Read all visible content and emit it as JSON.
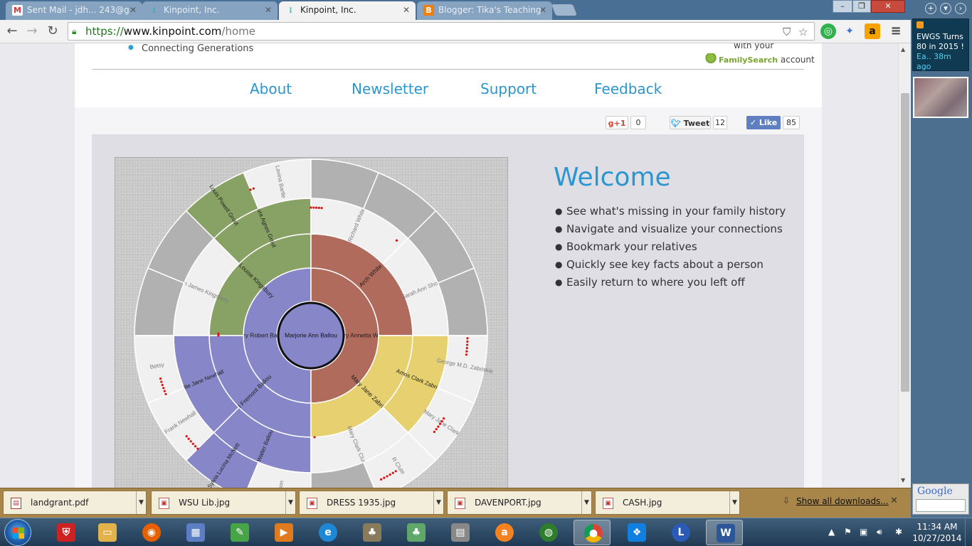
{
  "browser": {
    "tabs": [
      {
        "title": "Sent Mail - jdh... 243@g",
        "icon": "gmail-icon",
        "active": false
      },
      {
        "title": "Kinpoint, Inc.",
        "icon": "kinpoint-icon",
        "active": false
      },
      {
        "title": "Kinpoint, Inc.",
        "icon": "kinpoint-icon",
        "active": true
      },
      {
        "title": "Blogger: Tika's Teaching",
        "icon": "blogger-icon",
        "active": false
      }
    ],
    "url_scheme": "https://",
    "url_host": "www.kinpoint.com",
    "url_path": "/home"
  },
  "header": {
    "tagline": "Connecting Generations",
    "fs_with": "with your",
    "fs_brand": "FamilySearch",
    "fs_account": "account",
    "nav": [
      {
        "label": "About"
      },
      {
        "label": "Newsletter"
      },
      {
        "label": "Support"
      },
      {
        "label": "Feedback"
      }
    ]
  },
  "social": {
    "gplus_label": "g+1",
    "gplus_count": "0",
    "tweet_label": "Tweet",
    "tweet_count": "12",
    "like_label": "Like",
    "like_count": "85"
  },
  "welcome": {
    "title": "Welcome",
    "features": [
      "See what's missing in your family history",
      "Navigate and visualize your connections",
      "Bookmark your relatives",
      "Quickly see key facts about a person",
      "Easily return to where you left off"
    ]
  },
  "fan_chart": {
    "center": "Marjorie Ann Ballou",
    "colors": {
      "purple": "#8786c8",
      "red": "#b16b5c",
      "yellow": "#e6d06f",
      "green": "#88a164",
      "light": "#f0f0f0",
      "gray": "#b1b1b1",
      "dots": "#dd1111"
    },
    "people": [
      {
        "name": "Harry Robert Ballou",
        "gen": 1,
        "a0": 180,
        "a1": 360,
        "color": "purple"
      },
      {
        "name": "Mary Annetta White",
        "gen": 1,
        "a0": 0,
        "a1": 180,
        "color": "red"
      },
      {
        "name": "Cora Louise Kingsbury",
        "gen": 2,
        "a0": 270,
        "a1": 360,
        "color": "green"
      },
      {
        "name": "Fred Fremont Ballou",
        "gen": 2,
        "a0": 180,
        "a1": 270,
        "color": "purple"
      },
      {
        "name": "Arch White",
        "gen": 2,
        "a0": 0,
        "a1": 90,
        "color": "red"
      },
      {
        "name": "Mary Jane Zabriskie",
        "gen": 2,
        "a0": 90,
        "a1": 180,
        "color": "yellow"
      },
      {
        "name": "Laura Agnes Grout",
        "gen": 3,
        "a0": 315,
        "a1": 360,
        "color": "green"
      },
      {
        "name": "Edwin James Kingsbury",
        "gen": 3,
        "a0": 270,
        "a1": 315,
        "color": "light"
      },
      {
        "name": "Nellie Jane Newhall",
        "gen": 3,
        "a0": 225,
        "a1": 270,
        "color": "purple"
      },
      {
        "name": "Walter Ballou",
        "gen": 3,
        "a0": 180,
        "a1": 225,
        "color": "purple"
      },
      {
        "name": "Richard White",
        "gen": 3,
        "a0": 0,
        "a1": 45,
        "color": "light"
      },
      {
        "name": "Sarah Ann Short",
        "gen": 3,
        "a0": 45,
        "a1": 90,
        "color": "light"
      },
      {
        "name": "Amos Clark Zabriskie",
        "gen": 3,
        "a0": 90,
        "a1": 135,
        "color": "yellow"
      },
      {
        "name": "Mary Clark Clute",
        "gen": 3,
        "a0": 135,
        "a1": 180,
        "color": "light"
      },
      {
        "name": "Lavina Bartle",
        "gen": 4,
        "a0": 337.5,
        "a1": 360,
        "color": "light"
      },
      {
        "name": "Louis Powell Grout",
        "gen": 4,
        "a0": 315,
        "a1": 337.5,
        "color": "green"
      },
      {
        "name": "",
        "gen": 4,
        "a0": 292.5,
        "a1": 315,
        "color": "gray"
      },
      {
        "name": "",
        "gen": 4,
        "a0": 270,
        "a1": 292.5,
        "color": "gray"
      },
      {
        "name": "Betsy",
        "gen": 4,
        "a0": 247.5,
        "a1": 270,
        "color": "light"
      },
      {
        "name": "Frank Newhall",
        "gen": 4,
        "a0": 225,
        "a1": 247.5,
        "color": "light"
      },
      {
        "name": "Sylvia Lucina McNett",
        "gen": 4,
        "a0": 202.5,
        "a1": 225,
        "color": "purple"
      },
      {
        "name": "Nelson",
        "gen": 4,
        "a0": 180,
        "a1": 202.5,
        "color": "light"
      },
      {
        "name": "",
        "gen": 4,
        "a0": 0,
        "a1": 22.5,
        "color": "gray"
      },
      {
        "name": "",
        "gen": 4,
        "a0": 22.5,
        "a1": 45,
        "color": "gray"
      },
      {
        "name": "",
        "gen": 4,
        "a0": 45,
        "a1": 67.5,
        "color": "gray"
      },
      {
        "name": "",
        "gen": 4,
        "a0": 67.5,
        "a1": 90,
        "color": "gray"
      },
      {
        "name": "George M.D. Zabriskie",
        "gen": 4,
        "a0": 90,
        "a1": 112.5,
        "color": "light"
      },
      {
        "name": "Mary Jane Clark",
        "gen": 4,
        "a0": 112.5,
        "a1": 135,
        "color": "light"
      },
      {
        "name": "R Clute",
        "gen": 4,
        "a0": 135,
        "a1": 157.5,
        "color": "light"
      },
      {
        "name": "",
        "gen": 4,
        "a0": 157.5,
        "a1": 180,
        "color": "gray"
      }
    ]
  },
  "downloads": {
    "items": [
      {
        "name": "landgrant.pdf"
      },
      {
        "name": "WSU Lib.jpg"
      },
      {
        "name": "DRESS 1935.jpg"
      },
      {
        "name": "DAVENPORT.jpg"
      },
      {
        "name": "CASH.jpg"
      }
    ],
    "show_all": "Show all downloads..."
  },
  "sidebar": {
    "rss_title": "EWGS Turns 80 in 2015 !",
    "rss_meta": "Ea.. 38m ago",
    "google_label": "Google"
  },
  "taskbar": {
    "time": "11:34 AM",
    "date": "10/27/2014"
  }
}
